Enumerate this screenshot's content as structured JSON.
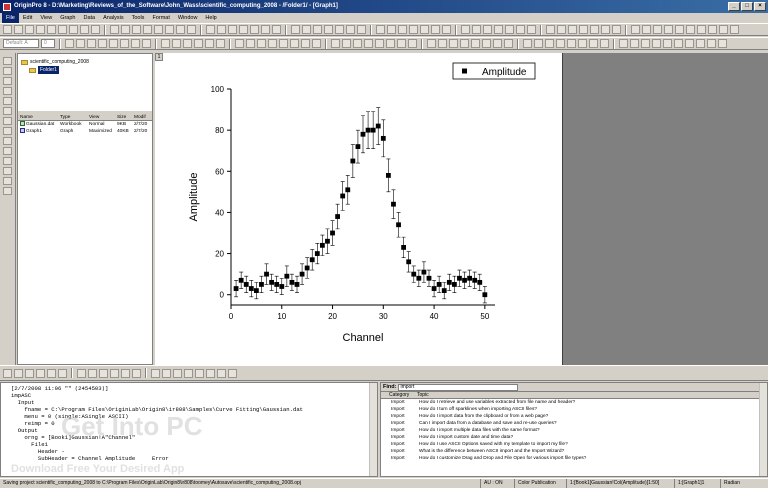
{
  "window": {
    "title": "OriginPro 8 - D:\\Marketing\\Reviews_of_the_Software\\John_Wass\\scientific_computing_2008 - /Folder1/ - [Graph1]",
    "controls": [
      "_",
      "□",
      "×"
    ]
  },
  "menu": [
    "File",
    "Edit",
    "View",
    "Graph",
    "Data",
    "Analysis",
    "Tools",
    "Format",
    "Window",
    "Help"
  ],
  "toolbar": {
    "font_combo": "Default: A",
    "size_combo": "0"
  },
  "explorer": {
    "project": "scientific_computing_2008",
    "folder": "Folder1",
    "columns": [
      "Name",
      "Type",
      "View",
      "Size",
      "Modif"
    ],
    "rows": [
      {
        "name": "Gaussian.dat",
        "type": "Workbook",
        "view": "Normal",
        "size": "9KB",
        "modified": "2/7/20"
      },
      {
        "name": "Graph1",
        "type": "Graph",
        "view": "Maximized",
        "size": "40KB",
        "modified": "2/7/20"
      }
    ]
  },
  "page_tab": "1",
  "chart_data": {
    "type": "scatter",
    "xlabel": "Channel",
    "ylabel": "Amplitude",
    "xlim": [
      0,
      52
    ],
    "ylim": [
      -5,
      100
    ],
    "xticks": [
      0,
      10,
      20,
      30,
      40,
      50
    ],
    "yticks": [
      0,
      20,
      40,
      60,
      80,
      100
    ],
    "legend_position": "top-right",
    "series": [
      {
        "name": "Amplitude",
        "x": [
          1,
          2,
          3,
          4,
          5,
          6,
          7,
          8,
          9,
          10,
          11,
          12,
          13,
          14,
          15,
          16,
          17,
          18,
          19,
          20,
          21,
          22,
          23,
          24,
          25,
          26,
          27,
          28,
          29,
          30,
          31,
          32,
          33,
          34,
          35,
          36,
          37,
          38,
          39,
          40,
          41,
          42,
          43,
          44,
          45,
          46,
          47,
          48,
          49,
          50
        ],
        "y": [
          3,
          7,
          5,
          3,
          2,
          5,
          10,
          6,
          5,
          4,
          9,
          6,
          5,
          10,
          13,
          17,
          20,
          24,
          26,
          30,
          38,
          48,
          51,
          65,
          72,
          78,
          80,
          80,
          82,
          76,
          58,
          44,
          34,
          23,
          16,
          10,
          8,
          11,
          8,
          3,
          5,
          2,
          6,
          5,
          8,
          7,
          8,
          7,
          6,
          0
        ],
        "error": [
          4,
          4,
          4,
          4,
          4,
          4,
          5,
          4,
          4,
          4,
          5,
          4,
          4,
          5,
          5,
          5,
          5,
          5,
          6,
          6,
          6,
          7,
          7,
          8,
          8,
          9,
          9,
          9,
          9,
          9,
          8,
          7,
          6,
          5,
          5,
          4,
          4,
          5,
          4,
          4,
          4,
          4,
          4,
          4,
          4,
          4,
          4,
          4,
          4,
          4
        ]
      }
    ]
  },
  "command_window": {
    "lines": [
      "[2/7/2008 11:06 \"\" (2454503)]",
      "impASC",
      "  Input",
      "    fname = C:\\Program Files\\OriginLab\\Origin8\\ir808\\Samples\\Curve Fitting\\Gaussian.dat",
      "    menu = 0 (single:ASingle ASCII)",
      "    reimp = 0",
      "  Output",
      "    orng = [Book1]Gaussian!A\"Channel\"",
      "      File1",
      "        Header -",
      "        SubHeader = Channel Amplitude     Error"
    ]
  },
  "find": {
    "label": "Find:",
    "query": "import",
    "columns": [
      "Category",
      "Topic"
    ],
    "rows": [
      {
        "category": "Import",
        "topic": "How do I retrieve and use variables extracted from file name and header?"
      },
      {
        "category": "Import",
        "topic": "How do I turn off sparklines when importing ASCII files?"
      },
      {
        "category": "Import",
        "topic": "How do I import data from the clipboard or from a web page?"
      },
      {
        "category": "Import",
        "topic": "Can I import data from a database and save and re-use queries?"
      },
      {
        "category": "Import",
        "topic": "How do I import multiple data files with the same format?"
      },
      {
        "category": "Import",
        "topic": "How do I import custom date and time data?"
      },
      {
        "category": "Import",
        "topic": "How do I use ASCII Options saved with my template to import my file?"
      },
      {
        "category": "Import",
        "topic": "What is the difference between ASCII import and the Import Wizard?"
      },
      {
        "category": "Import",
        "topic": "How do I customize Drag and Drop and File Open for various import file types?"
      }
    ]
  },
  "watermark": {
    "brand": "Get Into PC",
    "tagline": "Download Free Your Desired App"
  },
  "status": {
    "message": "Saving project scientific_computing_2008 to C:\\Program Files\\OriginLab\\Origin8\\ir808\\toomey\\Autosave\\scientific_computing_2008.opj",
    "au": "AU : ON",
    "mode": "Color Publication",
    "range": "1:[Book1]Gaussian!Col(Amplitude)[1:50]",
    "layer": "1:[Graph1]1",
    "angle": "Radian"
  }
}
